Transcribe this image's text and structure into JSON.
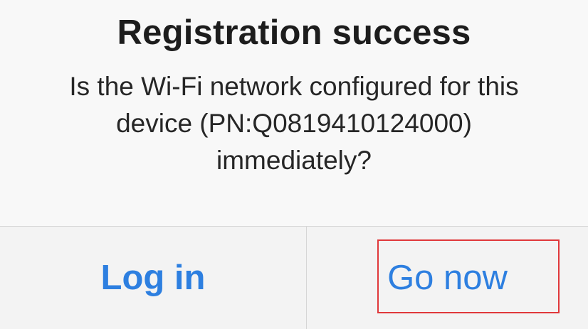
{
  "dialog": {
    "title": "Registration success",
    "message_lines": [
      "Is the Wi-Fi network configured for this",
      "device (PN:Q0819410124000)",
      "immediately?"
    ],
    "buttons": {
      "login_label": "Log in",
      "go_now_label": "Go now"
    }
  },
  "colors": {
    "button_text": "#2d7fe0",
    "title_text": "#1d1d1d",
    "highlight_border": "#e0383b",
    "background": "#f8f8f8"
  }
}
